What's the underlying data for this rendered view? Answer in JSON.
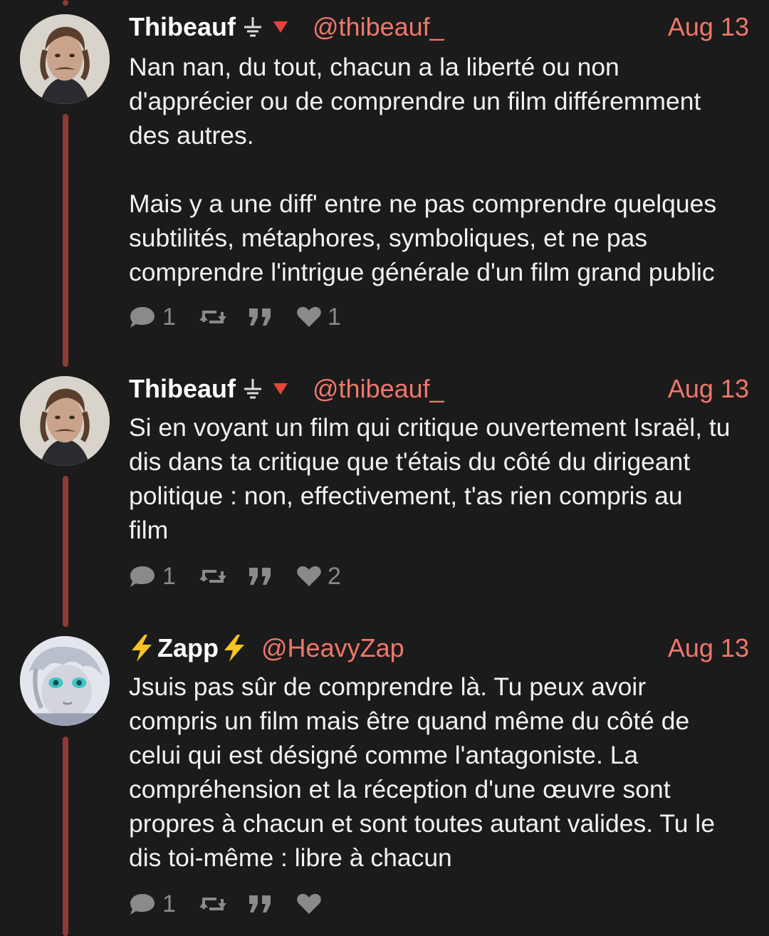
{
  "colors": {
    "background": "#1b1b1b",
    "accent": "#f0776a",
    "thread_line": "#8e3a35",
    "icon_gray": "#8a8a8a"
  },
  "posts": [
    {
      "author": "Thibeauf",
      "handle": "@thibeauf_",
      "date": "Aug 13",
      "text": "Nan nan, du tout, chacun a la liberté ou non\nd'apprécier ou de comprendre un film différemment\ndes autres.\n\nMais y a une diff' entre ne pas comprendre quelques\nsubtilités, métaphores, symboliques, et ne pas\ncomprendre l'intrigue générale d'un film grand public",
      "replies": "1",
      "likes": "1"
    },
    {
      "author": "Thibeauf",
      "handle": "@thibeauf_",
      "date": "Aug 13",
      "text": "Si en voyant un film qui critique ouvertement Israël, tu\ndis dans ta critique que t'étais du côté du dirigeant\npolitique : non, effectivement, t'as rien compris au\nfilm",
      "replies": "1",
      "likes": "2"
    },
    {
      "author": "Zapp",
      "handle": "@HeavyZap",
      "date": "Aug 13",
      "text": "Jsuis pas sûr de comprendre là. Tu peux avoir\ncompris un film mais être quand même du côté de\ncelui qui est désigné comme l'antagoniste. La\ncompréhension et la réception d'une œuvre sont\npropres à chacun et sont toutes autant valides. Tu le\ndis toi-même : libre à chacun",
      "replies": "1",
      "likes": ""
    }
  ],
  "icons": {
    "reply": "speech-bubble-icon",
    "repost": "repost-arrows-icon",
    "quote": "quote-marks-icon",
    "like": "heart-icon",
    "ground": "ground-symbol-icon",
    "triangle": "red-triangle-down-icon",
    "zap": "lightning-bolt-icon"
  }
}
